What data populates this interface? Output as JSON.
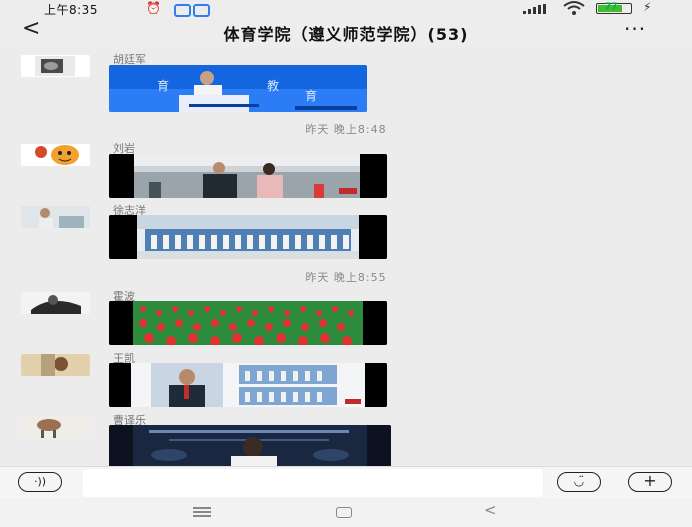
{
  "status_bar": {
    "time": "上午8:35",
    "alarm_icon": "alarm-clock-icon",
    "battery_percent": "77",
    "battery_level": 0.77,
    "battery_color": "#3fbf2f"
  },
  "header": {
    "back_glyph": "<",
    "title": "体育学院（遵义师范学院）(53)",
    "more_glyph": "···"
  },
  "messages": {
    "items": [
      {
        "sender": "胡廷军",
        "content": "image"
      },
      {
        "sender": "刘岩",
        "content": "image"
      },
      {
        "sender": "徐志洋",
        "content": "image"
      },
      {
        "sender": "霍波",
        "content": "image"
      },
      {
        "sender": "王凯",
        "content": "image"
      },
      {
        "sender": "曹译乐",
        "content": "image"
      }
    ],
    "timestamps": [
      "昨天 晚上8:48",
      "昨天 晚上8:55"
    ]
  },
  "input_bar": {
    "voice_icon": "voice-icon",
    "emoji_icon": "emoji-icon",
    "plus_icon": "plus-icon",
    "plus_glyph": "+",
    "voice_glyph": "·))",
    "emoji_glyph": "◡̈",
    "input_value": ""
  },
  "nav_bar": {
    "back_glyph": "<"
  },
  "colors": {
    "accent_blue": "#2f7ff0",
    "background": "#ececec"
  }
}
